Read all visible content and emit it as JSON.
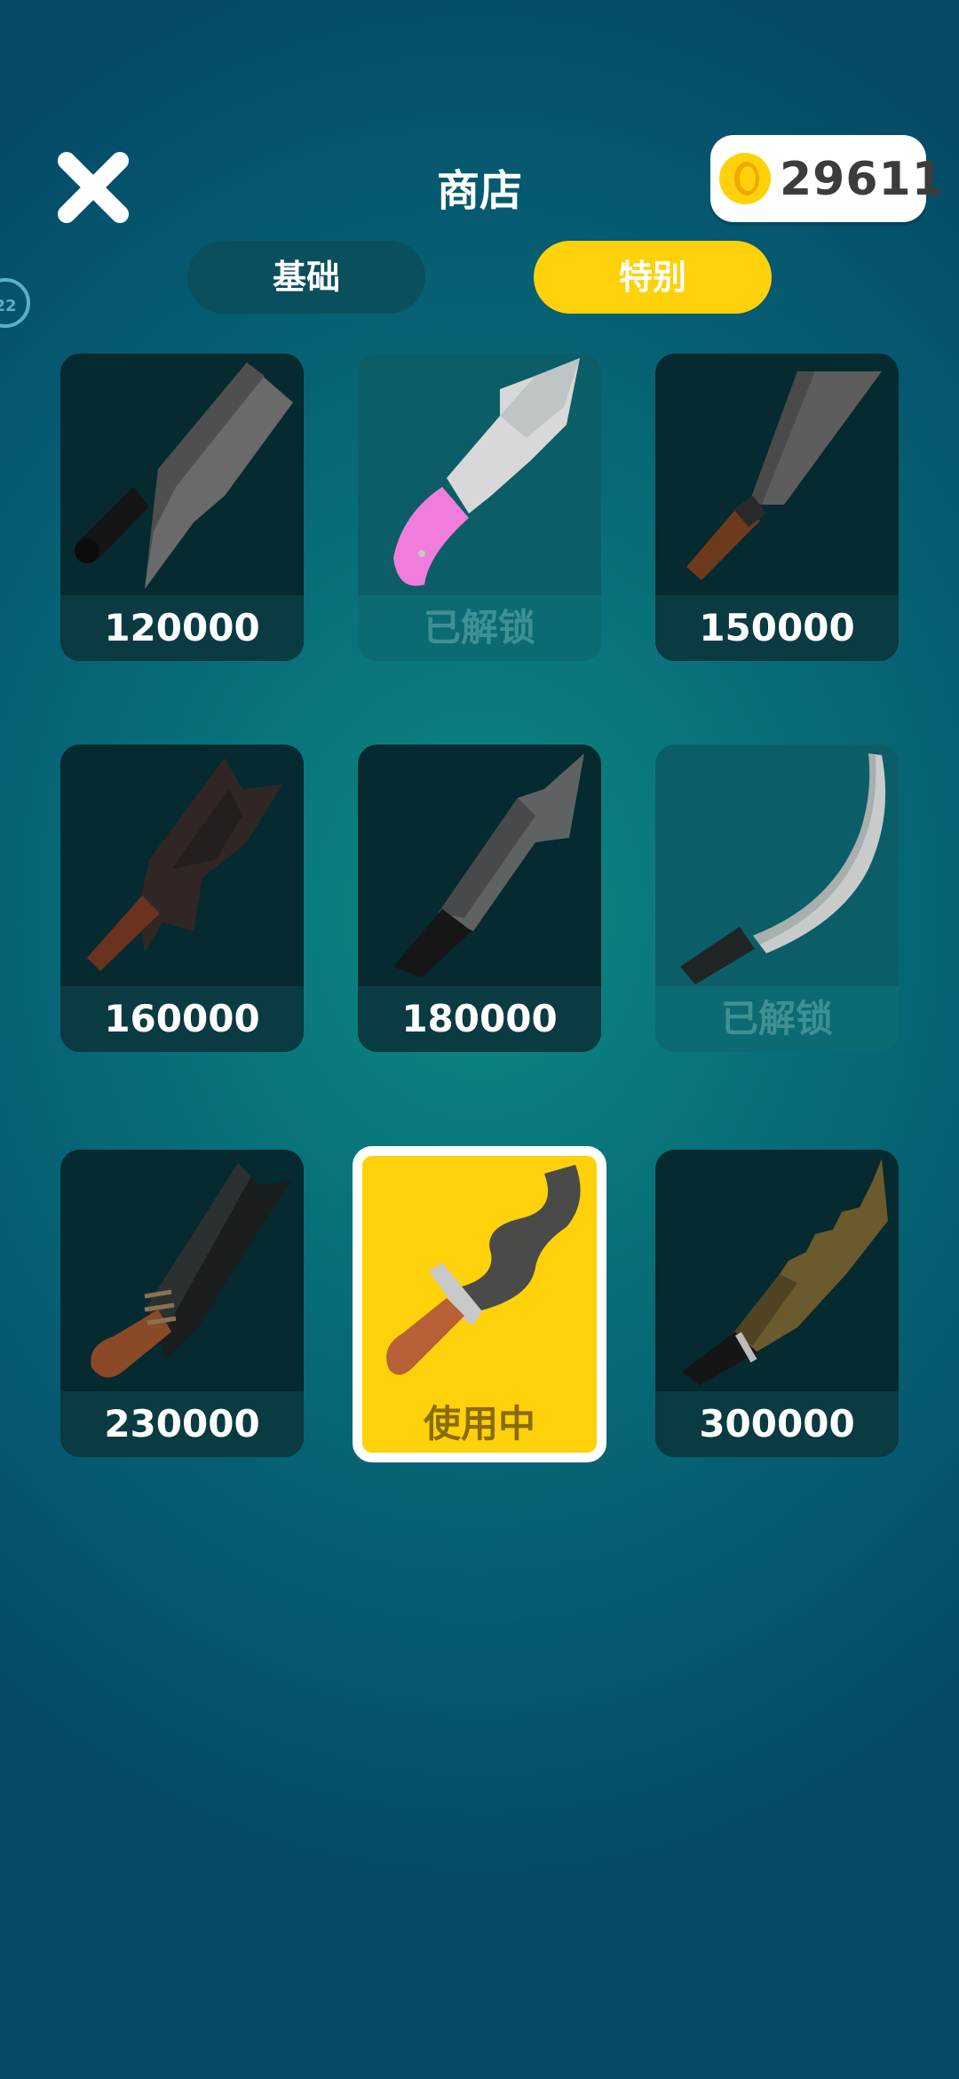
{
  "header": {
    "title": "商店",
    "coins": "29611"
  },
  "side_badge": "22",
  "tabs": [
    {
      "label": "基础",
      "active": false
    },
    {
      "label": "特别",
      "active": true
    }
  ],
  "items": [
    {
      "label": "120000",
      "state": "locked",
      "icon": "cleaver-icon"
    },
    {
      "label": "已解锁",
      "state": "unlocked",
      "icon": "pink-handle-knife-icon"
    },
    {
      "label": "150000",
      "state": "locked",
      "icon": "nakiri-knife-icon"
    },
    {
      "label": "160000",
      "state": "locked",
      "icon": "jagged-cleaver-icon"
    },
    {
      "label": "180000",
      "state": "locked",
      "icon": "spear-knife-icon"
    },
    {
      "label": "已解锁",
      "state": "unlocked",
      "icon": "curved-blade-icon"
    },
    {
      "label": "230000",
      "state": "locked",
      "icon": "machete-icon"
    },
    {
      "label": "使用中",
      "state": "in-use",
      "icon": "kris-dagger-icon"
    },
    {
      "label": "300000",
      "state": "locked",
      "icon": "serrated-blade-icon"
    }
  ],
  "colors": {
    "accent": "#fed10a",
    "tab_inactive": "#0a4f5d",
    "card_dark": "#052a2f",
    "card_unlocked": "#0b5e68"
  }
}
